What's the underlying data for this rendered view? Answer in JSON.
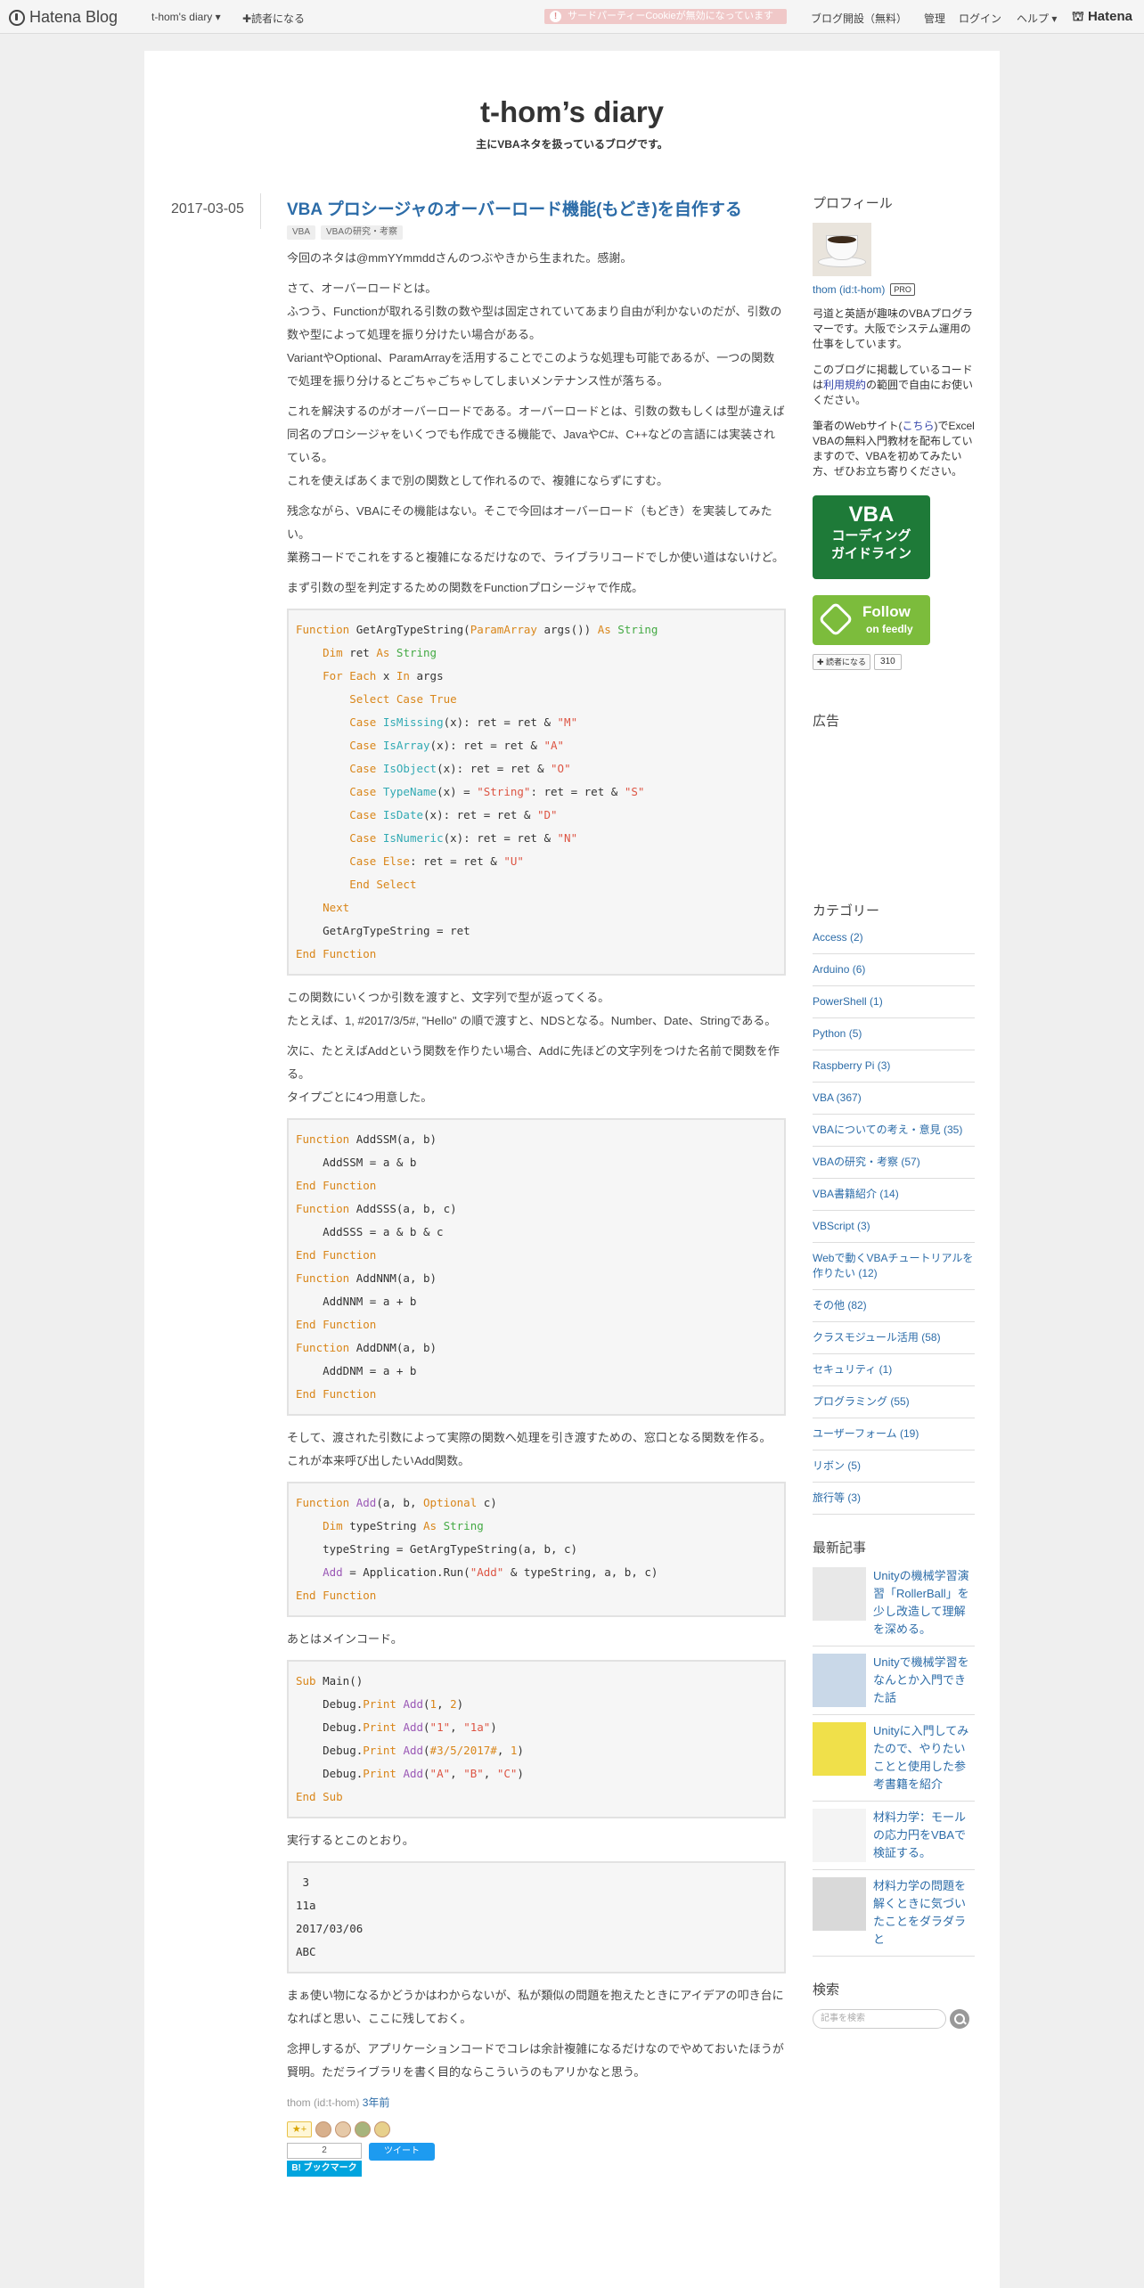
{
  "topbar": {
    "logo": "Hatena Blog",
    "diary_menu": "t-hom's diary ▾",
    "reader": "✚読者になる",
    "cookie_notice": "サードパーティーCookieが無効になっています",
    "links": [
      "ブログ開設（無料）",
      "管理",
      "ログイン",
      "ヘルプ ▾"
    ],
    "hatena": "Hatena"
  },
  "blog": {
    "title": "t-hom’s diary",
    "description": "主にVBAネタを扱っているブログです。"
  },
  "entry": {
    "date": "2017-03-05",
    "title": "VBA プロシージャのオーバーロード機能(もどき)を自作する",
    "categories": [
      "VBA",
      "VBAの研究・考察"
    ],
    "p1": "今回のネタは@mmYYmmddさんのつぶやきから生まれた。感謝。",
    "p2": "さて、オーバーロードとは。\nふつう、Functionが取れる引数の数や型は固定されていてあまり自由が利かないのだが、引数の数や型によって処理を振り分けたい場合がある。\nVariantやOptional、ParamArrayを活用することでこのような処理も可能であるが、一つの関数で処理を振り分けるとごちゃごちゃしてしまいメンテナンス性が落ちる。",
    "p3": "これを解決するのがオーバーロードである。オーバーロードとは、引数の数もしくは型が違えば同名のプロシージャをいくつでも作成できる機能で、JavaやC#、C++などの言語には実装されている。\nこれを使えばあくまで別の関数として作れるので、複雑にならずにすむ。",
    "p4": "残念ながら、VBAにその機能はない。そこで今回はオーバーロード（もどき）を実装してみたい。\n業務コードでこれをすると複雑になるだけなので、ライブラリコードでしか使い道はないけど。",
    "p5": "まず引数の型を判定するための関数をFunctionプロシージャで作成。",
    "p6": "この関数にいくつか引数を渡すと、文字列で型が返ってくる。\nたとえば、1, #2017/3/5#, \"Hello\" の順で渡すと、NDSとなる。Number、Date、Stringである。",
    "p7": "次に、たとえばAddという関数を作りたい場合、Addに先ほどの文字列をつけた名前で関数を作る。\nタイプごとに4つ用意した。",
    "p8": "そして、渡された引数によって実際の関数へ処理を引き渡すための、窓口となる関数を作る。\nこれが本来呼び出したいAdd関数。",
    "p9": "あとはメインコード。",
    "p10": "実行するとこのとおり。",
    "output": " 3\n11a\n2017/03/06\nABC",
    "p11": "まぁ使い物になるかどうかはわからないが、私が類似の問題を抱えたときにアイデアの叩き台になればと思い、ここに残しておく。",
    "p12": "念押しするが、アプリケーションコードでコレは余計複雑になるだけなのでやめておいたほうが賢明。ただライブラリを書く目的ならこういうのもアリかなと思う。",
    "author": "thom (id:t-hom)",
    "posted": "3年前",
    "star_btn": "★+",
    "bookmark_count": "2",
    "bookmark_btn": "B! ブックマーク",
    "tweet_btn": "ツイート"
  },
  "sidebar": {
    "profile_heading": "プロフィール",
    "profile_name": "thom (id:t-hom)",
    "pro_badge": "PRO",
    "bio1": "弓道と英語が趣味のVBAプログラマーです。大阪でシステム運用の仕事をしています。",
    "bio2_prefix": "このブログに掲載しているコードは",
    "bio2_link": "利用規約",
    "bio2_suffix": "の範囲で自由にお使いください。",
    "bio3_prefix": "筆者のWebサイト(",
    "bio3_link": "こちら",
    "bio3_suffix": ")でExcel VBAの無料入門教材を配布していますので、VBAを初めてみたい方、ぜひお立ち寄りください。",
    "vba_badge_big": "VBA",
    "vba_badge_l1": "コーディング",
    "vba_badge_l2": "ガイドライン",
    "feedly_t1": "Follow",
    "feedly_t2": "on feedly",
    "reader_btn": "✚ 読者になる",
    "reader_count": "310",
    "ad_heading": "広告",
    "category_heading": "カテゴリー",
    "categories": [
      "Access (2)",
      "Arduino (6)",
      "PowerShell (1)",
      "Python (5)",
      "Raspberry Pi (3)",
      "VBA (367)",
      "VBAについての考え・意見 (35)",
      "VBAの研究・考察 (57)",
      "VBA書籍紹介 (14)",
      "VBScript (3)",
      "Webで動くVBAチュートリアルを作りたい (12)",
      "その他 (82)",
      "クラスモジュール活用 (58)",
      "セキュリティ (1)",
      "プログラミング (55)",
      "ユーザーフォーム (19)",
      "リボン (5)",
      "旅行等 (3)"
    ],
    "recent_heading": "最新記事",
    "recent": [
      "Unityの機械学習演習「RollerBall」を少し改造して理解を深める。",
      "Unityで機械学習をなんとか入門できた話",
      "Unityに入門してみたので、やりたいことと使用した参考書籍を紹介",
      "材料力学：モールの応力円をVBAで検証する。",
      "材料力学の問題を解くときに気づいたことをダラダラと"
    ],
    "search_heading": "検索",
    "search_placeholder": "記事を検索"
  },
  "colors": {
    "link": "#2c6ca8",
    "keyword": "#d9861a",
    "type": "#44aa44",
    "builtin_fn": "#32aab4",
    "string": "#dd5544",
    "vba_badge": "#1e7a38",
    "feedly": "#7cbc3c"
  },
  "icons": [
    "hatena-logo-icon",
    "alert-icon",
    "star-icon",
    "search-icon",
    "feedly-icon",
    "coffee-cup-icon"
  ]
}
